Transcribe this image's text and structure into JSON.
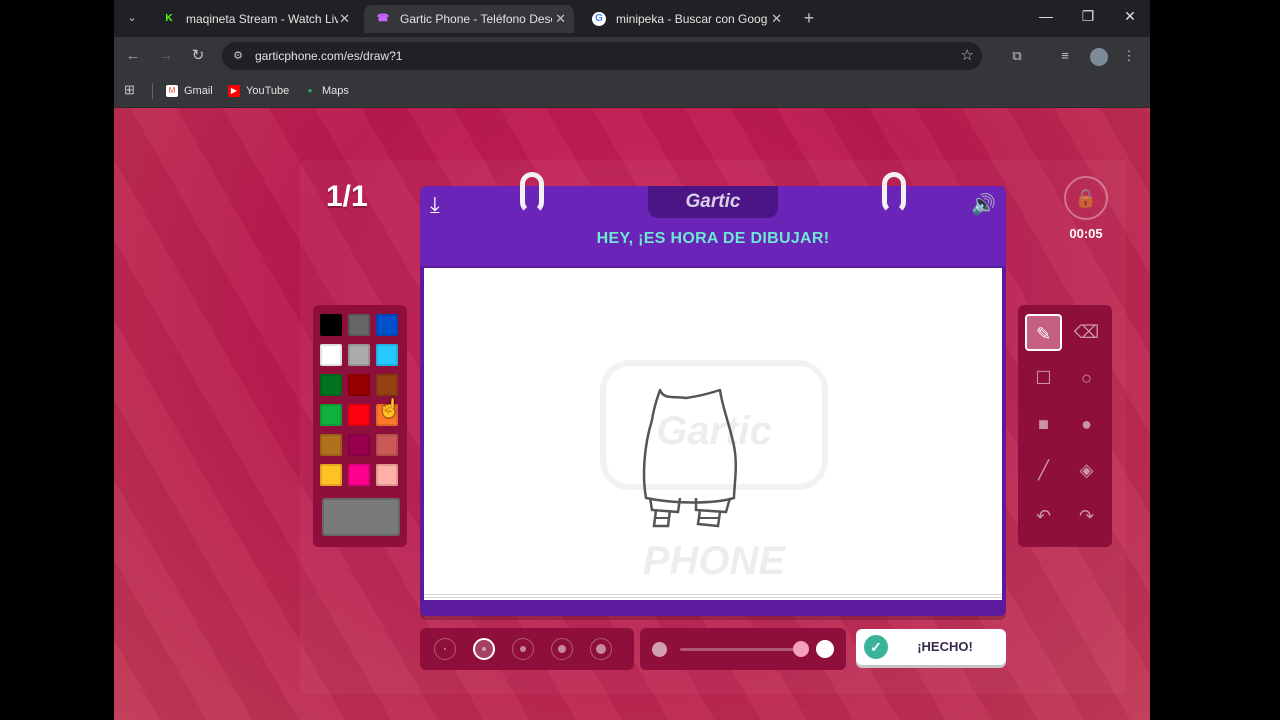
{
  "browser": {
    "tabs": [
      {
        "title": "maqineta Stream - Watch Live c",
        "favicon": "kick-icon",
        "color": "#53fc18"
      },
      {
        "title": "Gartic Phone - Teléfono Descon",
        "favicon": "gartic-icon",
        "color": "#c864ff"
      },
      {
        "title": "minipeka - Buscar con Google",
        "favicon": "google-icon",
        "color": "#4285f4"
      }
    ],
    "active_tab": 1,
    "url": "garticphone.com/es/draw?1",
    "bookmarks": [
      {
        "label": "Gmail"
      },
      {
        "label": "YouTube"
      },
      {
        "label": "Maps"
      }
    ]
  },
  "game": {
    "round": "1/1",
    "timer": "00:05",
    "logo": "Gartic",
    "headline": "HEY, ¡ES HORA DE DIBUJAR!",
    "done_label": "¡HECHO!",
    "watermark": "Gartic PHONE",
    "current_color": "#7a7a7a",
    "palette": [
      "#000000",
      "#666666",
      "#0050cd",
      "#ffffff",
      "#aaaaaa",
      "#26c9ff",
      "#017420",
      "#990000",
      "#964112",
      "#11b03c",
      "#ff0013",
      "#ff7829",
      "#b0701c",
      "#99004e",
      "#cb5a57",
      "#ffc126",
      "#ff008f",
      "#feafa8"
    ],
    "tools": [
      "pencil-tool",
      "eraser-tool",
      "rectangle-tool",
      "ellipse-tool",
      "filled-rectangle-tool",
      "filled-ellipse-tool",
      "line-tool",
      "fill-bucket-tool",
      "undo-tool",
      "redo-tool"
    ],
    "selected_tool": "pencil-tool",
    "brush_sizes": 5,
    "selected_brush_size": 2
  }
}
